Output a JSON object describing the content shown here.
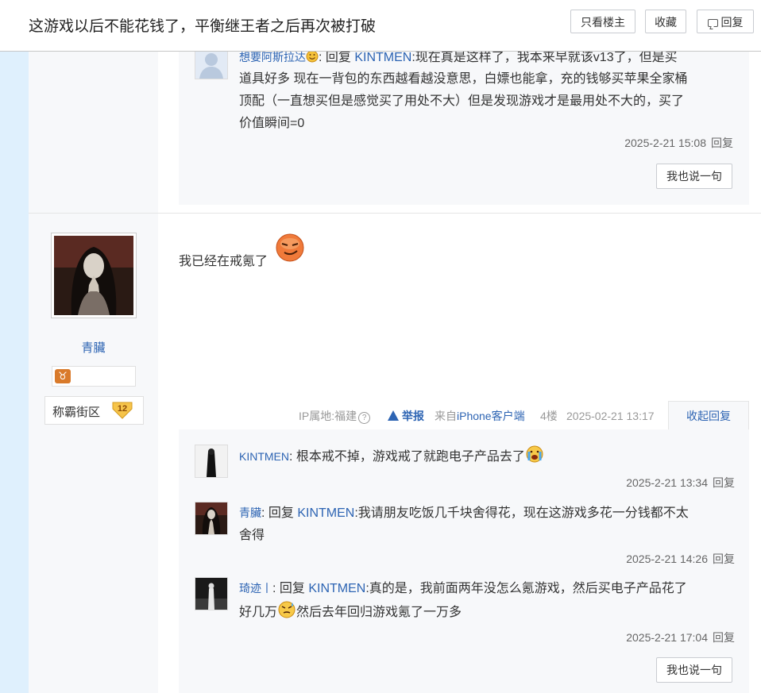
{
  "header": {
    "title": "这游戏以后不能花钱了，平衡继王者之后再次被打破",
    "only_author": "只看楼主",
    "favorite": "收藏",
    "reply": "回复"
  },
  "top_reply": {
    "user": "想要阿斯拉达",
    "reply_prefix": "回复",
    "reply_to": "KINTMEN",
    "line1": ":现在真是这样了，我本来早就该v13了，但是买",
    "line2": "道具好多 现在一背包的东西越看越没意思，白嫖也能拿，充的钱够买苹果全家桶",
    "line3": "顶配（一直想买但是感觉买了用处不大）但是发现游戏才是最用处不大的，买了",
    "line4": "价值瞬间=0",
    "time": "2025-2-21 15:08",
    "meta_reply": "回复",
    "say_button": "我也说一句"
  },
  "post": {
    "author": "青臟",
    "level_name": "称霸街区",
    "level_num": "12",
    "content": "我已经在戒氪了",
    "ip": "IP属地:福建",
    "report": "举报",
    "from_prefix": "来自",
    "from_client": "iPhone客户端",
    "floor": "4楼",
    "date": "2025-02-21 13:17",
    "collapse": "收起回复"
  },
  "replies": [
    {
      "user": "KINTMEN",
      "text": "根本戒不掉，游戏戒了就跑电子产品去了",
      "time": "2025-2-21 13:34",
      "meta_reply": "回复"
    },
    {
      "user": "青臟",
      "reply_prefix": "回复",
      "reply_to": "KINTMEN",
      "line1": ":我请朋友吃饭几千块舍得花，现在这游戏多花一分钱都不太",
      "line2": "舍得",
      "time": "2025-2-21 14:26",
      "meta_reply": "回复"
    },
    {
      "user": "琦迹丨",
      "reply_prefix": "回复",
      "reply_to": "KINTMEN",
      "line1": ":真的是，我前面两年没怎么氪游戏，然后买电子产品花了",
      "line2a": "好几万",
      "line2b": "然后去年回归游戏氪了一万多",
      "time": "2025-2-21 17:04",
      "meta_reply": "回复"
    }
  ],
  "bottom_say_button": "我也说一句"
}
